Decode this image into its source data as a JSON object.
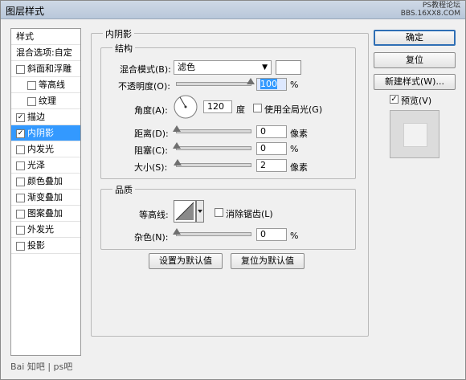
{
  "window": {
    "title": "图层样式"
  },
  "watermark": {
    "line1": "PS教程论坛",
    "line2": "BBS.16XX8.COM"
  },
  "style_list": {
    "header_styles": "样式",
    "header_blend": "混合选项:自定",
    "items": [
      {
        "label": "斜面和浮雕",
        "checked": false
      },
      {
        "label": "等高线",
        "checked": false
      },
      {
        "label": "纹理",
        "checked": false
      },
      {
        "label": "描边",
        "checked": true
      },
      {
        "label": "内阴影",
        "checked": true,
        "selected": true
      },
      {
        "label": "内发光",
        "checked": false
      },
      {
        "label": "光泽",
        "checked": false
      },
      {
        "label": "颜色叠加",
        "checked": false
      },
      {
        "label": "渐变叠加",
        "checked": false
      },
      {
        "label": "图案叠加",
        "checked": false
      },
      {
        "label": "外发光",
        "checked": false
      },
      {
        "label": "投影",
        "checked": false
      }
    ]
  },
  "panel": {
    "title": "内阴影",
    "structure": {
      "title": "结构",
      "blend_mode_label": "混合模式(B):",
      "blend_mode_value": "滤色",
      "opacity_label": "不透明度(O):",
      "opacity_value": "100",
      "opacity_unit": "%",
      "opacity_fraction": 1.0,
      "angle_label": "角度(A):",
      "angle_value": "120",
      "angle_unit": "度",
      "global_light_label": "使用全局光(G)",
      "global_light_checked": false,
      "distance_label": "距离(D):",
      "distance_value": "0",
      "distance_unit": "像素",
      "distance_fraction": 0.0,
      "choke_label": "阻塞(C):",
      "choke_value": "0",
      "choke_unit": "%",
      "choke_fraction": 0.0,
      "size_label": "大小(S):",
      "size_value": "2",
      "size_unit": "像素",
      "size_fraction": 0.01
    },
    "quality": {
      "title": "品质",
      "contour_label": "等高线:",
      "antialias_label": "消除锯齿(L)",
      "antialias_checked": false,
      "noise_label": "杂色(N):",
      "noise_value": "0",
      "noise_unit": "%",
      "noise_fraction": 0.0
    },
    "set_default": "设置为默认值",
    "reset_default": "复位为默认值"
  },
  "buttons": {
    "ok": "确定",
    "reset": "复位",
    "new_style": "新建样式(W)...",
    "preview": "预览(V)",
    "preview_checked": true
  },
  "footer": {
    "text": "Bai 知吧 | ps吧"
  }
}
